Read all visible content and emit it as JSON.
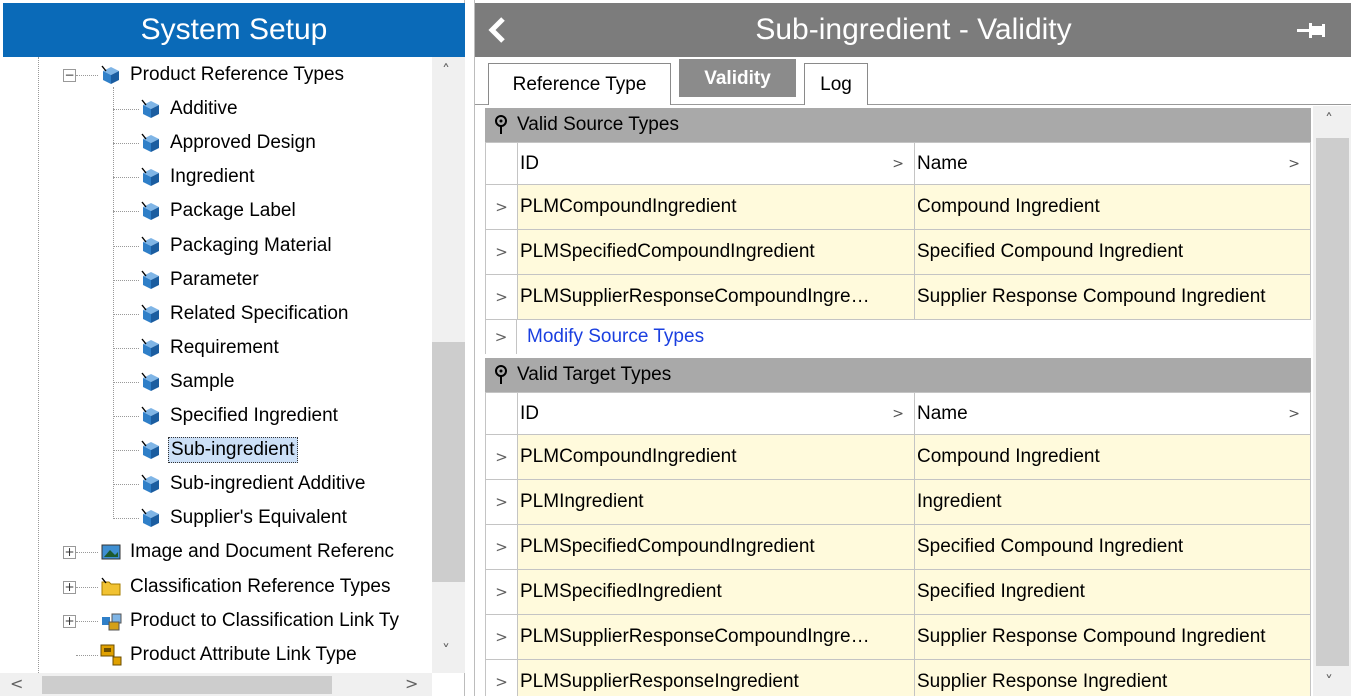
{
  "left_panel": {
    "title": "System Setup",
    "tree": [
      {
        "label": "Product Reference Types",
        "level": 1,
        "expander": "minus",
        "icon": "cube-icon"
      },
      {
        "label": "Additive",
        "level": 2,
        "icon": "cube-icon"
      },
      {
        "label": "Approved Design",
        "level": 2,
        "icon": "cube-icon"
      },
      {
        "label": "Ingredient",
        "level": 2,
        "icon": "cube-icon"
      },
      {
        "label": "Package Label",
        "level": 2,
        "icon": "cube-icon"
      },
      {
        "label": "Packaging Material",
        "level": 2,
        "icon": "cube-icon"
      },
      {
        "label": "Parameter",
        "level": 2,
        "icon": "cube-icon"
      },
      {
        "label": "Related Specification",
        "level": 2,
        "icon": "cube-icon"
      },
      {
        "label": "Requirement",
        "level": 2,
        "icon": "cube-icon"
      },
      {
        "label": "Sample",
        "level": 2,
        "icon": "cube-icon"
      },
      {
        "label": "Specified Ingredient",
        "level": 2,
        "icon": "cube-icon"
      },
      {
        "label": "Sub-ingredient",
        "level": 2,
        "icon": "cube-icon",
        "selected": true
      },
      {
        "label": "Sub-ingredient Additive",
        "level": 2,
        "icon": "cube-icon"
      },
      {
        "label": "Supplier's Equivalent",
        "level": 2,
        "icon": "cube-icon"
      },
      {
        "label": "Image and Document Referenc",
        "level": 1,
        "expander": "plus",
        "icon": "image-icon"
      },
      {
        "label": "Classification Reference Types",
        "level": 1,
        "expander": "plus",
        "icon": "folder-icon"
      },
      {
        "label": "Product to Classification Link Ty",
        "level": 1,
        "expander": "plus",
        "icon": "link-type-icon"
      },
      {
        "label": "Product Attribute Link Type",
        "level": 1,
        "icon": "attribute-link-icon"
      }
    ]
  },
  "right_panel": {
    "title": "Sub-ingredient - Validity",
    "tabs": [
      {
        "label": "Reference Type",
        "active": false
      },
      {
        "label": "Validity",
        "active": true
      },
      {
        "label": "Log",
        "active": false
      }
    ],
    "source_section": {
      "header": "Valid Source Types",
      "columns": {
        "id": "ID",
        "name": "Name"
      },
      "rows": [
        {
          "id": "PLMCompoundIngredient",
          "name": "Compound Ingredient"
        },
        {
          "id": "PLMSpecifiedCompoundIngredient",
          "name": "Specified Compound Ingredient"
        },
        {
          "id": "PLMSupplierResponseCompoundIngre…",
          "name": "Supplier Response Compound Ingredient"
        }
      ],
      "action_link": "Modify Source Types"
    },
    "target_section": {
      "header": "Valid Target Types",
      "columns": {
        "id": "ID",
        "name": "Name"
      },
      "rows": [
        {
          "id": "PLMCompoundIngredient",
          "name": "Compound Ingredient"
        },
        {
          "id": "PLMIngredient",
          "name": "Ingredient"
        },
        {
          "id": "PLMSpecifiedCompoundIngredient",
          "name": "Specified Compound Ingredient"
        },
        {
          "id": "PLMSpecifiedIngredient",
          "name": "Specified Ingredient"
        },
        {
          "id": "PLMSupplierResponseCompoundIngre…",
          "name": "Supplier Response Compound Ingredient"
        },
        {
          "id": "PLMSupplierResponseIngredient",
          "name": "Supplier Response Ingredient"
        }
      ]
    }
  },
  "colors": {
    "left_title_bg": "#0a6ab8",
    "right_title_bg": "#7c7c7c",
    "row_bg": "#fffadc",
    "section_header_bg": "#a9a9a9",
    "link": "#1a3fe0",
    "selected_bg": "#cce0f7"
  }
}
